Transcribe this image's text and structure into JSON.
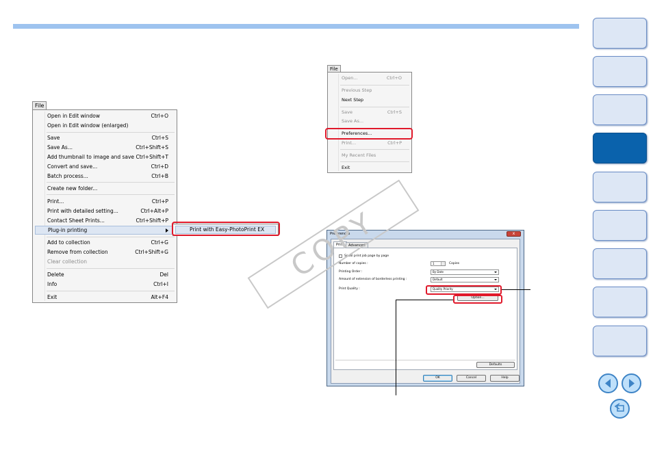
{
  "file_menu": {
    "title": "File",
    "items": [
      {
        "label": "Open in Edit window",
        "shortcut": "Ctrl+O"
      },
      {
        "label": "Open in Edit window (enlarged)",
        "shortcut": ""
      },
      {
        "label": "Save",
        "shortcut": "Ctrl+S"
      },
      {
        "label": "Save As...",
        "shortcut": "Ctrl+Shift+S"
      },
      {
        "label": "Add thumbnail to image and save",
        "shortcut": "Ctrl+Shift+T"
      },
      {
        "label": "Convert and save...",
        "shortcut": "Ctrl+D"
      },
      {
        "label": "Batch process...",
        "shortcut": "Ctrl+B"
      },
      {
        "label": "Create new folder...",
        "shortcut": ""
      },
      {
        "label": "Print...",
        "shortcut": "Ctrl+P"
      },
      {
        "label": "Print with detailed setting...",
        "shortcut": "Ctrl+Alt+P"
      },
      {
        "label": "Contact Sheet Prints...",
        "shortcut": "Ctrl+Shift+P"
      },
      {
        "label": "Plug-in printing",
        "shortcut": ""
      },
      {
        "label": "Add to collection",
        "shortcut": "Ctrl+G"
      },
      {
        "label": "Remove from collection",
        "shortcut": "Ctrl+Shift+G"
      },
      {
        "label": "Clear collection",
        "shortcut": ""
      },
      {
        "label": "Delete",
        "shortcut": "Del"
      },
      {
        "label": "Info",
        "shortcut": "Ctrl+I"
      },
      {
        "label": "Exit",
        "shortcut": "Alt+F4"
      }
    ],
    "submenu_item": "Print with Easy-PhotoPrint EX"
  },
  "file_menu_2": {
    "title": "File",
    "items": [
      {
        "label": "Open...",
        "shortcut": "Ctrl+O"
      },
      {
        "label": "Previous Step",
        "shortcut": ""
      },
      {
        "label": "Next Step",
        "shortcut": ""
      },
      {
        "label": "Save",
        "shortcut": "Ctrl+S"
      },
      {
        "label": "Save As...",
        "shortcut": ""
      },
      {
        "label": "Preferences...",
        "shortcut": ""
      },
      {
        "label": "Print...",
        "shortcut": "Ctrl+P"
      },
      {
        "label": "My Recent Files",
        "shortcut": ""
      },
      {
        "label": "Exit",
        "shortcut": ""
      }
    ]
  },
  "preferences": {
    "title": "Preferences",
    "close": "x",
    "tabs": [
      "Print",
      "Advanced"
    ],
    "spool_label": "Spool print job page by page",
    "copies_label": "Number of copies :",
    "copies_value": "1",
    "copies_unit": "Copies",
    "order_label": "Printing Order :",
    "order_value": "By Date",
    "extension_label": "Amount of extension of borderless printing :",
    "extension_value": "Default",
    "quality_label": "Print Quality :",
    "quality_value": "Quality Priority",
    "option_button": "Option...",
    "defaults_button": "Defaults",
    "ok_button": "OK",
    "cancel_button": "Cancel",
    "help_button": "Help"
  },
  "watermark": "COPY",
  "nav": {
    "active_index": 3,
    "tab_count": 9,
    "accent": "#0a62ac",
    "highlight": "#e0182a"
  }
}
